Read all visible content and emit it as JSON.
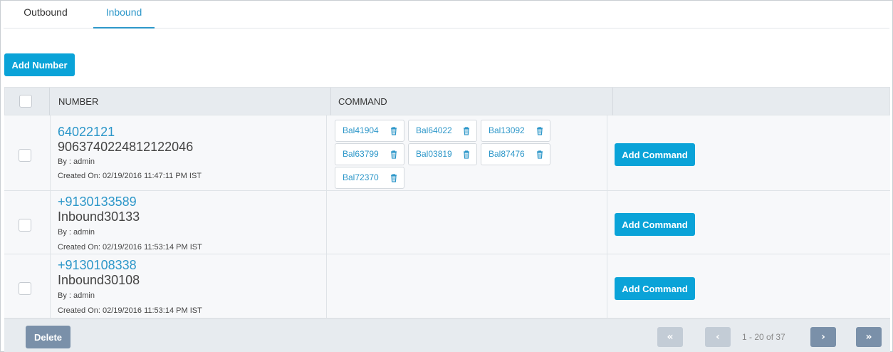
{
  "tabs": [
    {
      "label": "Outbound",
      "active": false
    },
    {
      "label": "Inbound",
      "active": true
    }
  ],
  "toolbar": {
    "add_number_label": "Add Number"
  },
  "table": {
    "headers": {
      "number": "NUMBER",
      "command": "COMMAND"
    },
    "rows": [
      {
        "number": "64022121",
        "name": "9063740224812122046",
        "by": "By : admin",
        "created": "Created On: 02/19/2016 11:47:11 PM IST",
        "commands": [
          "Bal41904",
          "Bal64022",
          "Bal13092",
          "Bal63799",
          "Bal03819",
          "Bal87476",
          "Bal72370"
        ],
        "add_command_label": "Add Command"
      },
      {
        "number": "+9130133589",
        "name": "Inbound30133",
        "by": "By : admin",
        "created": "Created On: 02/19/2016 11:53:14 PM IST",
        "commands": [],
        "add_command_label": "Add Command"
      },
      {
        "number": "+9130108338",
        "name": "Inbound30108",
        "by": "By : admin",
        "created": "Created On: 02/19/2016 11:53:14 PM IST",
        "commands": [],
        "add_command_label": "Add Command"
      }
    ]
  },
  "footer": {
    "delete_label": "Delete",
    "pagination": {
      "first": "«",
      "prev": "‹",
      "info": "1 - 20 of 37",
      "next": "›",
      "last": "»"
    }
  },
  "colors": {
    "accent": "#0aa3d8",
    "link": "#2d97c9",
    "secondary_button": "#7a90a9",
    "disabled_button": "#c3ccd6",
    "header_bg": "#e7ebef"
  },
  "icons": {
    "chip_delete": "trash-icon"
  }
}
